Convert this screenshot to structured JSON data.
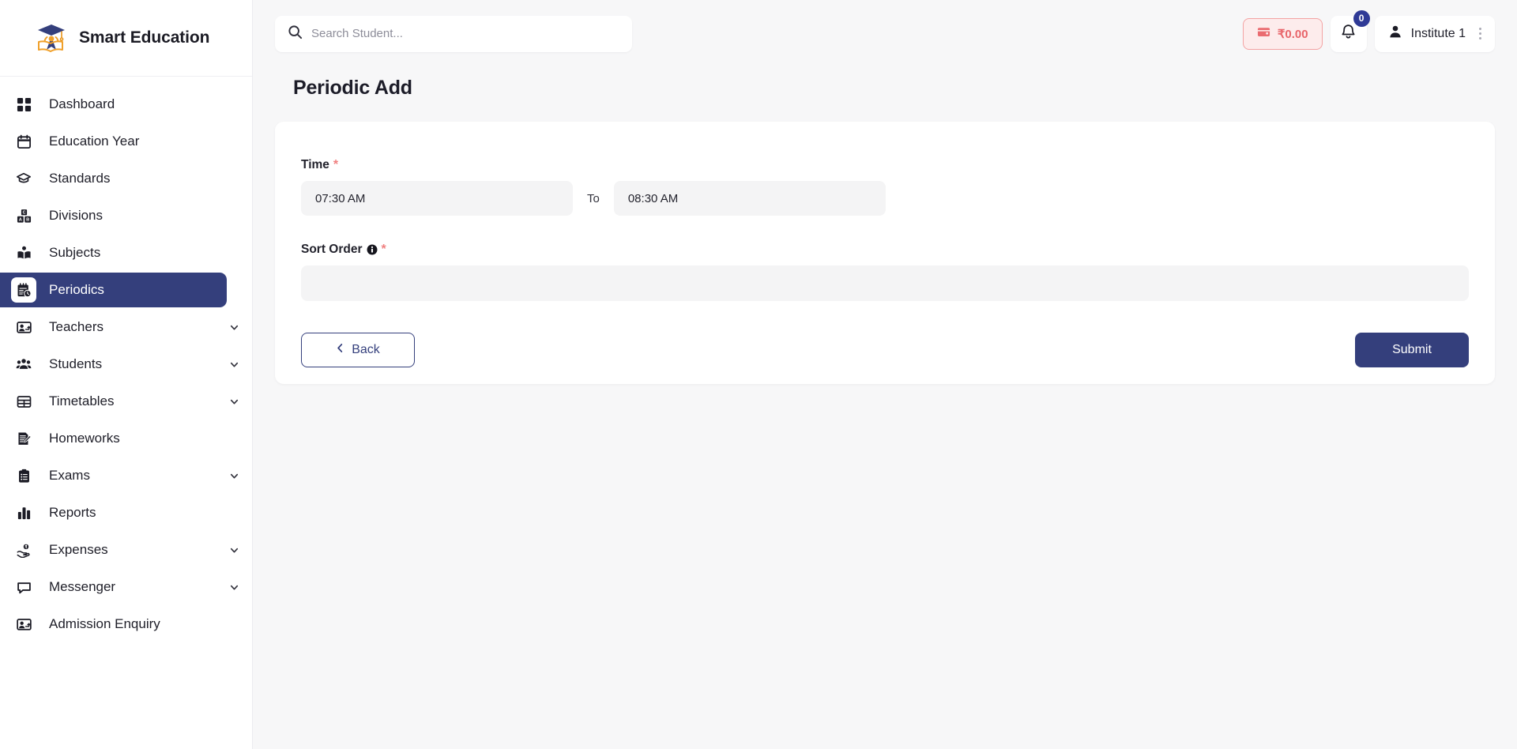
{
  "brand": {
    "name": "Smart Education",
    "logo_icon": "graduation-cap-book-logo"
  },
  "sidebar": {
    "items": [
      {
        "label": "Dashboard",
        "icon": "grid-squares-icon",
        "active": false,
        "expandable": false
      },
      {
        "label": "Education Year",
        "icon": "calendar-icon",
        "active": false,
        "expandable": false
      },
      {
        "label": "Standards",
        "icon": "graduation-cap-icon",
        "active": false,
        "expandable": false
      },
      {
        "label": "Divisions",
        "icon": "alphabet-blocks-icon",
        "active": false,
        "expandable": false
      },
      {
        "label": "Subjects",
        "icon": "open-book-icon",
        "active": false,
        "expandable": false
      },
      {
        "label": "Periodics",
        "icon": "calendar-clock-icon",
        "active": true,
        "expandable": false
      },
      {
        "label": "Teachers",
        "icon": "presentation-person-icon",
        "active": false,
        "expandable": true
      },
      {
        "label": "Students",
        "icon": "people-group-icon",
        "active": false,
        "expandable": true
      },
      {
        "label": "Timetables",
        "icon": "table-grid-icon",
        "active": false,
        "expandable": true
      },
      {
        "label": "Homeworks",
        "icon": "document-pencil-icon",
        "active": false,
        "expandable": false
      },
      {
        "label": "Exams",
        "icon": "clipboard-list-icon",
        "active": false,
        "expandable": true
      },
      {
        "label": "Reports",
        "icon": "bar-chart-icon",
        "active": false,
        "expandable": false
      },
      {
        "label": "Expenses",
        "icon": "hand-coins-icon",
        "active": false,
        "expandable": true
      },
      {
        "label": "Messenger",
        "icon": "chat-bubble-icon",
        "active": false,
        "expandable": true
      },
      {
        "label": "Admission Enquiry",
        "icon": "person-board-icon",
        "active": false,
        "expandable": false
      }
    ]
  },
  "topbar": {
    "search": {
      "placeholder": "Search Student...",
      "value": "",
      "icon": "search-icon"
    },
    "wallet": {
      "amount": "₹0.00",
      "icon": "wallet-icon"
    },
    "notifications": {
      "count": "0",
      "icon": "bell-icon"
    },
    "user": {
      "name": "Institute 1",
      "icon": "person-icon",
      "menu_icon": "kebab-menu-icon"
    }
  },
  "main": {
    "page_title": "Periodic Add",
    "form": {
      "time": {
        "label": "Time",
        "required_mark": "*",
        "from_value": "07:30 AM",
        "from_placeholder": "",
        "separator_label": "To",
        "to_value": "08:30 AM",
        "to_placeholder": ""
      },
      "sort_order": {
        "label": "Sort Order",
        "info_icon": "info-circle-icon",
        "required_mark": "*",
        "value": "",
        "placeholder": ""
      },
      "back_button": "Back",
      "back_icon": "chevron-left-icon",
      "submit_button": "Submit"
    }
  },
  "colors": {
    "accent_navy": "#343f7c",
    "wallet_red": "#e8656a",
    "wallet_bg": "#fdecec",
    "page_bg": "#f7f7f8",
    "input_bg": "#f4f4f5",
    "required_red": "#f08080"
  }
}
